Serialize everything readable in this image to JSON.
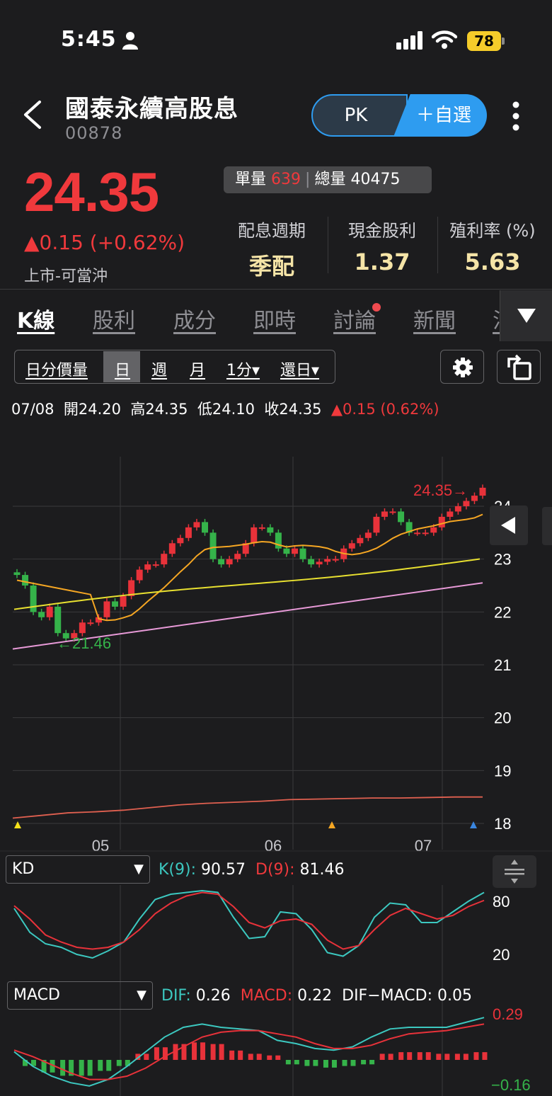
{
  "status_bar": {
    "time": "5:45",
    "battery": "78"
  },
  "header": {
    "name": "國泰永續高股息",
    "code": "00878",
    "pk_label": "PK",
    "fav_label": "＋自選"
  },
  "quote": {
    "price": "24.35",
    "change": "▲0.15 (+0.62%)",
    "market": "上市-可當沖",
    "unit_vol_label": "單量",
    "unit_vol": "639",
    "total_vol_label": "總量",
    "total_vol": "40475",
    "metrics": [
      {
        "label": "配息週期",
        "value": "季配"
      },
      {
        "label": "現金股利",
        "value": "1.37"
      },
      {
        "label": "殖利率 (%)",
        "value": "5.63"
      }
    ]
  },
  "tabs": [
    "K線",
    "股利",
    "成分",
    "即時",
    "討論",
    "新聞",
    "法"
  ],
  "periods": [
    "日分價量",
    "日",
    "週",
    "月",
    "1分▾",
    "還日▾"
  ],
  "ohlc": {
    "date": "07/08",
    "open": "開24.20",
    "high": "高24.35",
    "low": "低24.10",
    "close": "收24.35",
    "change": "▲0.15 (0.62%)"
  },
  "kd": {
    "selector": "KD",
    "k_label": "K(9):",
    "k_value": "90.57",
    "d_label": "D(9):",
    "d_value": "81.46"
  },
  "macd": {
    "selector": "MACD",
    "dif_label": "DIF:",
    "dif_value": "0.26",
    "macd_label": "MACD:",
    "macd_value": "0.22",
    "diff_label": "DIF−MACD:",
    "diff_value": "0.05"
  },
  "chart_data": [
    {
      "type": "candlestick",
      "y_ticks": [
        "24",
        "23",
        "22",
        "21",
        "20",
        "19",
        "18"
      ],
      "ylim": [
        18,
        24.4
      ],
      "x_ticks": [
        "05",
        "06",
        "07"
      ],
      "annotations": {
        "high": "24.35",
        "low": "21.46"
      },
      "colors": {
        "up": "#e8323a",
        "down": "#35b34a",
        "ma_orange": "#f5a623",
        "ma_yellow": "#e8e030",
        "ma_pink": "#e89ad8",
        "line": "#3a86e0",
        "bottom": "#e06050"
      },
      "closes": [
        22.7,
        22.5,
        22.0,
        21.9,
        22.1,
        21.6,
        21.5,
        21.6,
        21.8,
        21.8,
        21.9,
        22.2,
        22.1,
        22.3,
        22.6,
        22.8,
        22.9,
        22.9,
        23.1,
        23.3,
        23.4,
        23.6,
        23.7,
        23.5,
        23.0,
        22.9,
        23.0,
        23.1,
        23.3,
        23.6,
        23.6,
        23.5,
        23.2,
        23.1,
        23.2,
        23.0,
        22.9,
        22.95,
        23.0,
        23.0,
        23.2,
        23.3,
        23.4,
        23.5,
        23.8,
        23.9,
        23.9,
        23.7,
        23.5,
        23.5,
        23.5,
        23.6,
        23.8,
        23.9,
        24.0,
        24.1,
        24.2,
        24.35
      ]
    },
    {
      "type": "line",
      "title": "KD",
      "y_ticks": [
        "80",
        "20"
      ],
      "series": [
        {
          "name": "K(9)",
          "values": [
            72,
            45,
            32,
            28,
            20,
            16,
            24,
            34,
            60,
            82,
            88,
            90,
            92,
            90,
            62,
            38,
            40,
            68,
            66,
            48,
            22,
            18,
            30,
            62,
            78,
            76,
            56,
            56,
            68,
            80,
            90
          ]
        },
        {
          "name": "D(9)",
          "values": [
            75,
            60,
            42,
            34,
            28,
            26,
            28,
            34,
            48,
            66,
            78,
            86,
            90,
            88,
            74,
            56,
            50,
            58,
            60,
            54,
            36,
            26,
            30,
            48,
            64,
            72,
            66,
            60,
            64,
            74,
            81
          ]
        }
      ]
    },
    {
      "type": "bar+line",
      "title": "MACD",
      "y_ticks": [
        "0.29",
        "−0.16"
      ],
      "series": [
        {
          "name": "DIF",
          "values": [
            0.05,
            -0.04,
            -0.1,
            -0.14,
            -0.16,
            -0.12,
            -0.04,
            0.05,
            0.14,
            0.2,
            0.22,
            0.2,
            0.19,
            0.18,
            0.12,
            0.1,
            0.07,
            0.06,
            0.08,
            0.14,
            0.19,
            0.2,
            0.2,
            0.2,
            0.23,
            0.26
          ]
        },
        {
          "name": "MACD",
          "values": [
            0.06,
            0.02,
            -0.03,
            -0.08,
            -0.12,
            -0.12,
            -0.1,
            -0.05,
            0.02,
            0.08,
            0.14,
            0.17,
            0.18,
            0.18,
            0.16,
            0.14,
            0.1,
            0.07,
            0.07,
            0.09,
            0.13,
            0.16,
            0.17,
            0.18,
            0.2,
            0.22
          ]
        }
      ],
      "histogram": [
        -0.02,
        -0.06,
        -0.08,
        -0.08,
        -0.05,
        -0.02,
        0.02,
        0.06,
        0.08,
        0.09,
        0.08,
        0.04,
        0.02,
        0.01,
        -0.01,
        -0.02,
        -0.03,
        -0.02,
        -0.01,
        0.02,
        0.03,
        0.03,
        0.02,
        0.02,
        0.03,
        0.05
      ]
    }
  ]
}
